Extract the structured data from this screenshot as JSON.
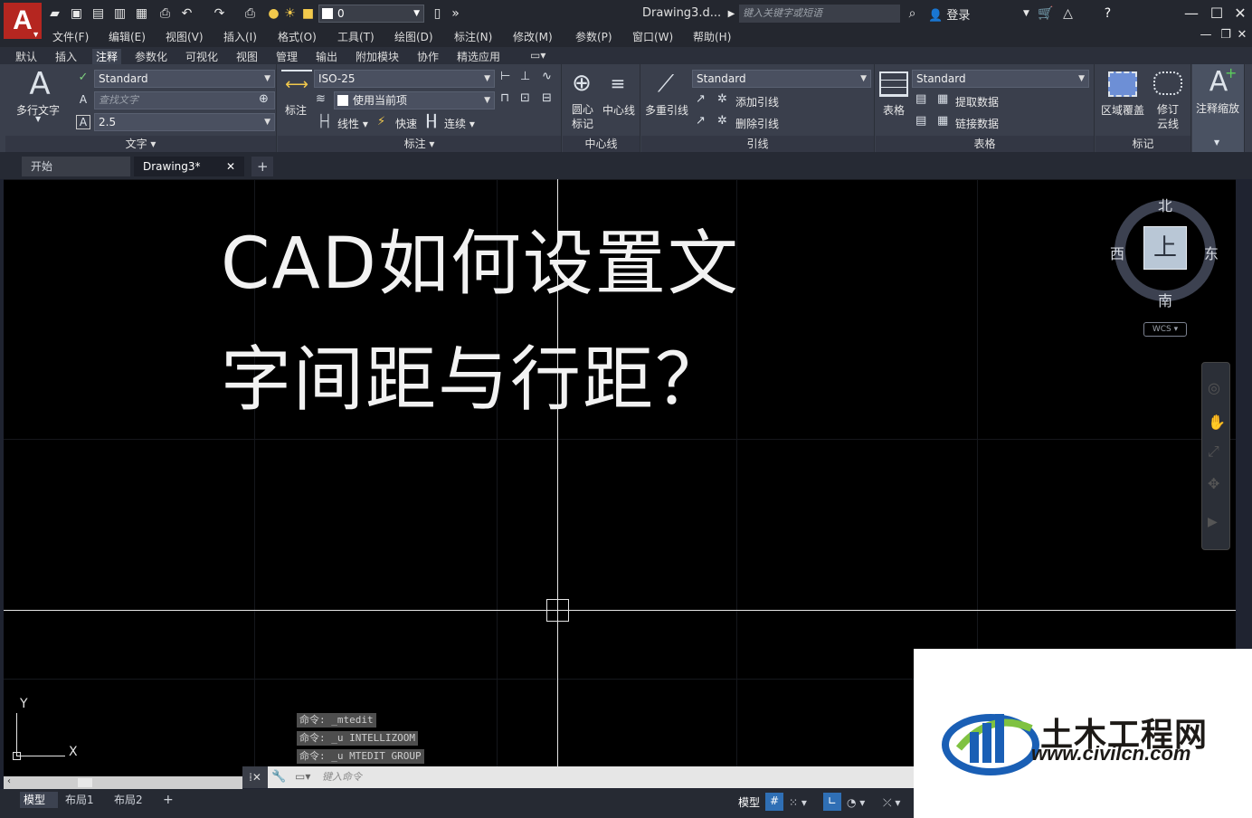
{
  "app": {
    "logo": "A",
    "doc_title": "Drawing3.d...",
    "search_placeholder": "键入关键字或短语",
    "login": "登录",
    "layer_value": "0"
  },
  "menu": [
    "文件(F)",
    "编辑(E)",
    "视图(V)",
    "插入(I)",
    "格式(O)",
    "工具(T)",
    "绘图(D)",
    "标注(N)",
    "修改(M)",
    "参数(P)",
    "窗口(W)",
    "帮助(H)"
  ],
  "ribbon_tabs": [
    "默认",
    "插入",
    "注释",
    "参数化",
    "可视化",
    "视图",
    "管理",
    "输出",
    "附加模块",
    "协作",
    "精选应用"
  ],
  "active_tab": "注释",
  "ribbon": {
    "text_panel": {
      "title": "文字",
      "big_button": "多行文字",
      "style_value": "Standard",
      "find_placeholder": "查找文字",
      "height_value": "2.5"
    },
    "dim_panel": {
      "title": "标注",
      "big_button": "标注",
      "style_value": "ISO-25",
      "layer_value": "使用当前项",
      "linear": "线性",
      "quick": "快速",
      "continue": "连续"
    },
    "center_panel": {
      "title": "中心线",
      "center_mark": "圆心\n标记",
      "center_mark_l1": "圆心",
      "center_mark_l2": "标记",
      "center_line": "中心线"
    },
    "leader_panel": {
      "title": "引线",
      "big_button": "多重引线",
      "style_value": "Standard",
      "add": "添加引线",
      "remove": "删除引线"
    },
    "table_panel": {
      "title": "表格",
      "big_button": "表格",
      "style_value": "Standard",
      "extract": "提取数据",
      "link": "链接数据"
    },
    "mark_panel": {
      "title": "标记",
      "wipeout": "区域覆盖",
      "revcloud_l1": "修订",
      "revcloud_l2": "云线"
    },
    "scale_panel": {
      "label": "注释缩放"
    }
  },
  "file_tabs": {
    "start": "开始",
    "drawing": "Drawing3*"
  },
  "canvas": {
    "line1": "CAD如何设置文",
    "line2": "字间距与行距？"
  },
  "viewcube": {
    "north": "北",
    "south": "南",
    "east": "东",
    "west": "西",
    "top": "上",
    "wcs": "WCS"
  },
  "ucs": {
    "x": "X",
    "y": "Y"
  },
  "command_history": [
    "命令: _mtedit",
    "命令: _u INTELLIZOOM",
    "命令: _u MTEDIT GROUP"
  ],
  "command_placeholder": "键入命令",
  "status": {
    "model": "模型",
    "layout1": "布局1",
    "layout2": "布局2",
    "model_btn": "模型"
  },
  "watermark": {
    "name": "土木工程网",
    "url": "www.civilcn.com"
  }
}
